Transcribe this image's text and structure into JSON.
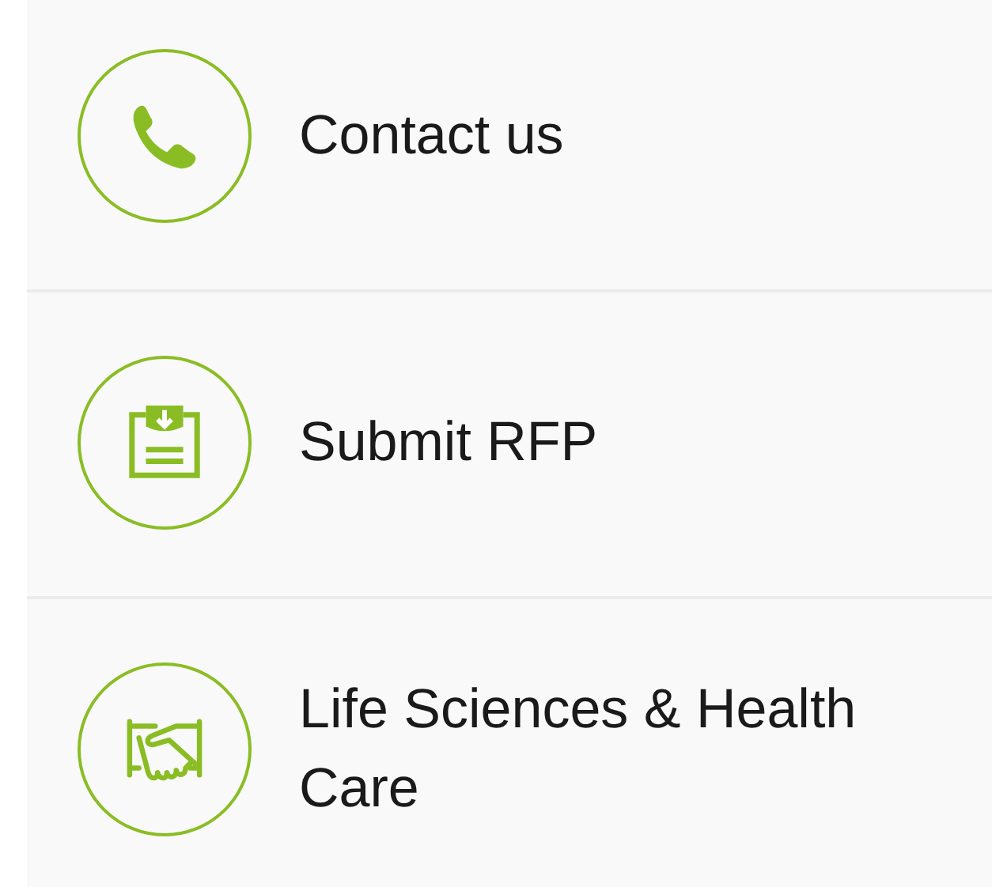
{
  "items": [
    {
      "kind": "phone",
      "label": "Contact us"
    },
    {
      "kind": "rfp",
      "label": "Submit RFP"
    },
    {
      "kind": "handshake",
      "label": "Life Sciences & Health Care"
    }
  ]
}
